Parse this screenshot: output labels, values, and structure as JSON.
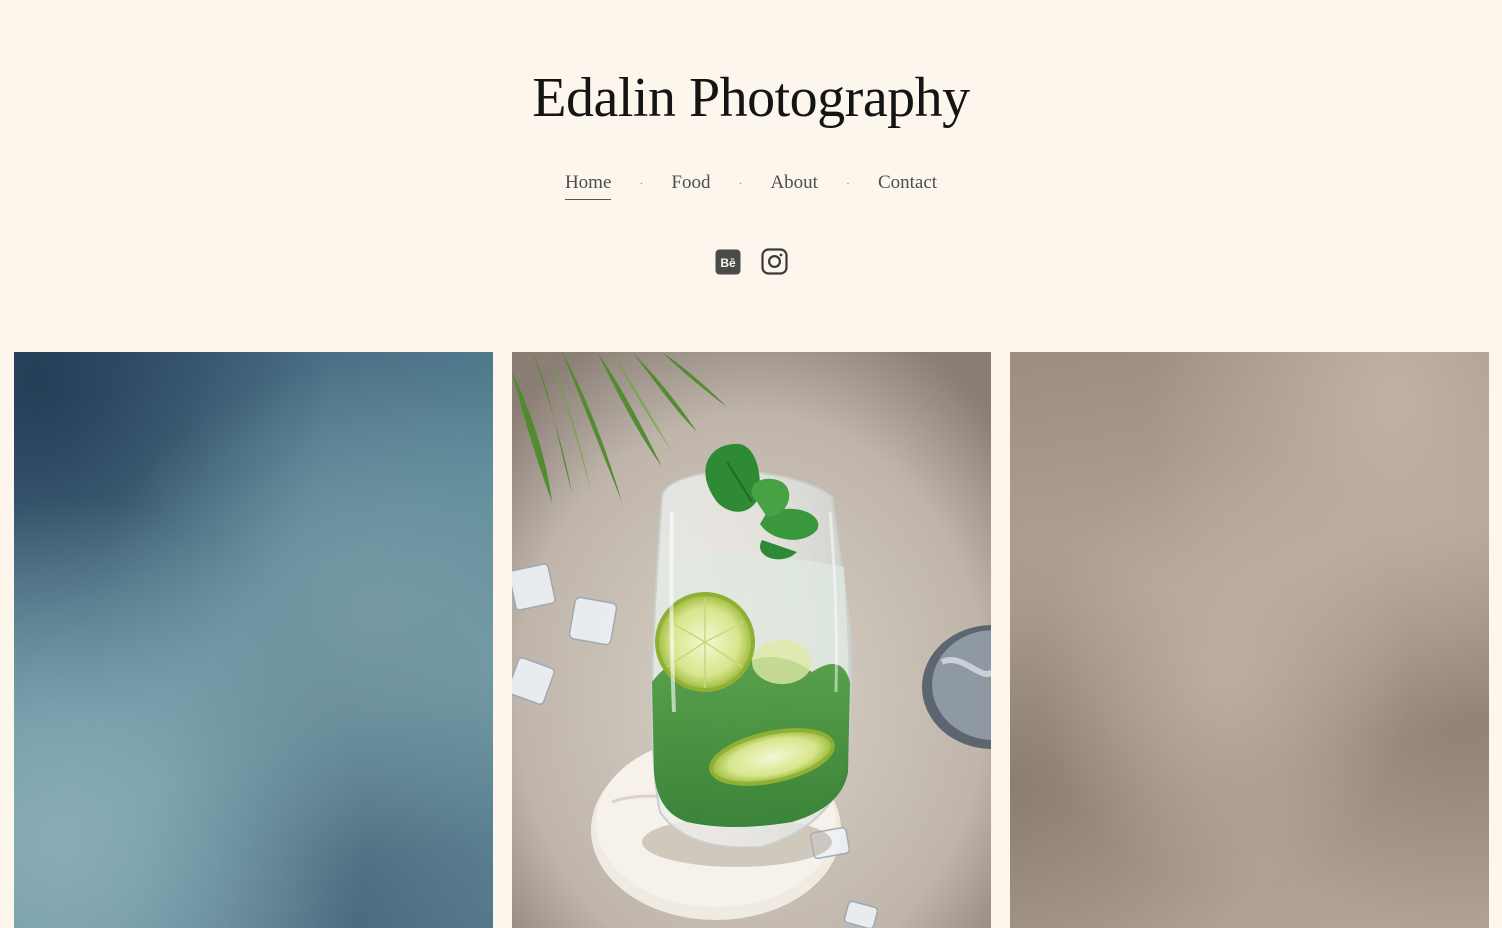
{
  "site": {
    "title": "Edalin Photography"
  },
  "nav": {
    "items": [
      {
        "label": "Home",
        "active": true
      },
      {
        "label": "Food",
        "active": false
      },
      {
        "label": "About",
        "active": false
      },
      {
        "label": "Contact",
        "active": false
      }
    ],
    "separator": "·"
  },
  "socials": [
    {
      "icon": "behance-icon",
      "glyph": "Bē"
    },
    {
      "icon": "instagram-icon"
    }
  ],
  "gallery": {
    "tiles": [
      {
        "subject": "blurred-blue-photo"
      },
      {
        "subject": "mojito-glass-photo"
      },
      {
        "subject": "blurred-beige-photo"
      }
    ]
  },
  "colors": {
    "background": "#fdf6ec",
    "text": "#141414",
    "nav_text": "#4e4e4e"
  }
}
